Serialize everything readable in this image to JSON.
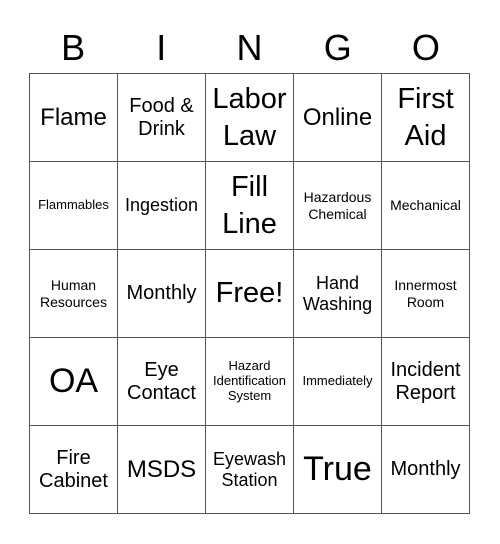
{
  "header": [
    "B",
    "I",
    "N",
    "G",
    "O"
  ],
  "cells": [
    {
      "text": "Flame",
      "size": "l"
    },
    {
      "text": "Food & Drink",
      "size": "mm"
    },
    {
      "text": "Labor Law",
      "size": "xl"
    },
    {
      "text": "Online",
      "size": "l"
    },
    {
      "text": "First Aid",
      "size": "xl"
    },
    {
      "text": "Flammables",
      "size": "xs"
    },
    {
      "text": "Ingestion",
      "size": "m"
    },
    {
      "text": "Fill Line",
      "size": "xl"
    },
    {
      "text": "Hazardous Chemical",
      "size": "s"
    },
    {
      "text": "Mechanical",
      "size": "s"
    },
    {
      "text": "Human Resources",
      "size": "s"
    },
    {
      "text": "Monthly",
      "size": "mm"
    },
    {
      "text": "Free!",
      "size": "xl"
    },
    {
      "text": "Hand Washing",
      "size": "m"
    },
    {
      "text": "Innermost Room",
      "size": "s"
    },
    {
      "text": "OA",
      "size": "xxl"
    },
    {
      "text": "Eye Contact",
      "size": "mm"
    },
    {
      "text": "Hazard Identification System",
      "size": "xs"
    },
    {
      "text": "Immediately",
      "size": "xs"
    },
    {
      "text": "Incident Report",
      "size": "mm"
    },
    {
      "text": "Fire Cabinet",
      "size": "mm"
    },
    {
      "text": "MSDS",
      "size": "l"
    },
    {
      "text": "Eyewash Station",
      "size": "m"
    },
    {
      "text": "True",
      "size": "xxl"
    },
    {
      "text": "Monthly",
      "size": "mm"
    }
  ]
}
